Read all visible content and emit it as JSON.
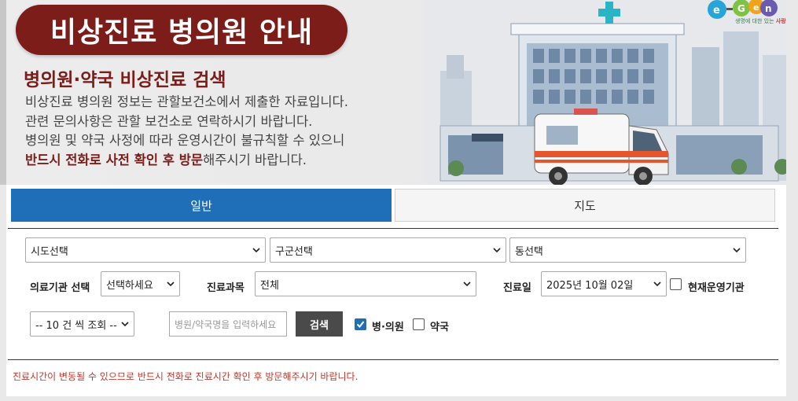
{
  "banner": {
    "title": "비상진료 병의원 안내",
    "subtitle": "병의원·약국 비상진료 검색",
    "lines": [
      "비상진료 병의원 정보는 관할보건소에서 제출한 자료입니다.",
      "관련 문의사항은 관할 보건소로 연락하시기 바랍니다.",
      "병의원 및 약국 사정에 따라 운영시간이 불규칙할 수 있으니"
    ],
    "line4_emph": "반드시 전화로 사전 확인 후 방문",
    "line4_rest": "해주시기 바랍니다.",
    "logo_sub_a": "생명",
    "logo_sub_b": "에 대한 있는 ",
    "logo_sub_c": "사랑"
  },
  "tabs": {
    "general": "일반",
    "map": "지도"
  },
  "filters": {
    "sido": "시도선택",
    "gugun": "구군선택",
    "dong": "동선택",
    "institution_label": "의료기관 선택",
    "institution_value": "선택하세요",
    "department_label": "진료과목",
    "department_value": "전체",
    "date_label": "진료일",
    "date_value": "2025년 10월 02일",
    "open_now_label": "현재운영기관",
    "open_now_checked": false,
    "page_size": "-- 10 건 씩 조회 --",
    "search_placeholder": "병원/약국명을 입력하세요",
    "search_button": "검색",
    "hospital_label": "병·의원",
    "hospital_checked": true,
    "pharmacy_label": "약국",
    "pharmacy_checked": false
  },
  "notice": "진료시간이 변동될 수 있으므로 반드시 전화로 진료시간 확인 후 방문해주시기 바랍니다.",
  "colors": {
    "brand_red": "#7d1d1a",
    "tab_blue": "#1e6fb8",
    "notice_red": "#c0392b"
  }
}
